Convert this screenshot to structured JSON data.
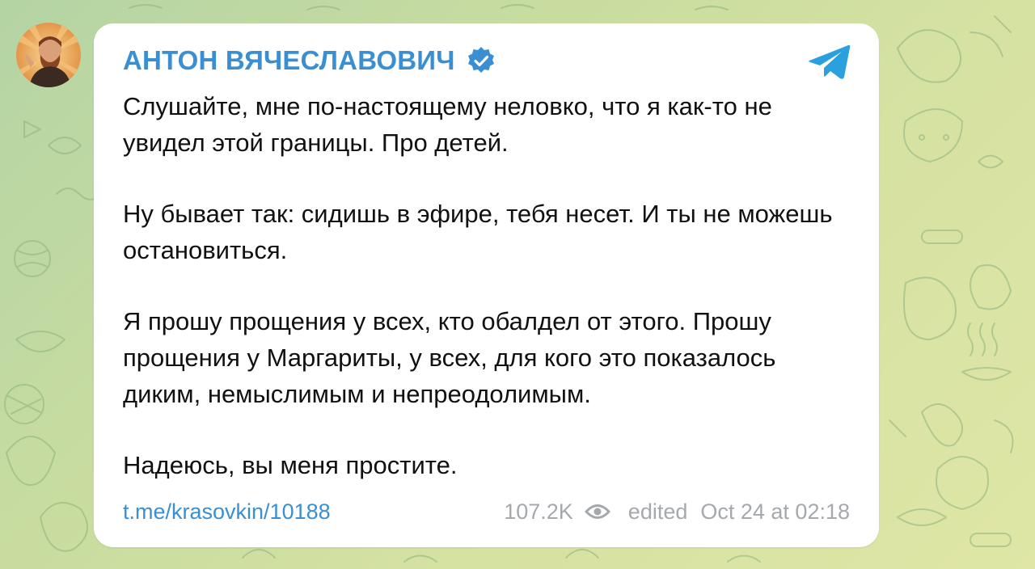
{
  "channel": {
    "name": "АНТОН ВЯЧЕСЛАВОВИЧ",
    "verified": true,
    "avatar_icon": "user-avatar-icon"
  },
  "message": {
    "paragraphs": [
      "Слушайте, мне по-настоящему неловко, что я как-то не увидел этой границы. Про детей.",
      "Ну бывает так: сидишь в эфире, тебя несет. И ты не можешь остановиться.",
      "Я прошу прощения у всех, кто обалдел от этого. Прошу прощения у Маргариты, у всех, для кого это показалось диким, немыслимым и непреодолимым.",
      "Надеюсь, вы меня простите."
    ],
    "link": "t.me/krasovkin/10188",
    "views": "107.2K",
    "edited_label": "edited",
    "timestamp": "Oct 24 at 02:18"
  },
  "icons": {
    "verified": "verified-badge-icon",
    "views": "eye-icon",
    "brand": "telegram-icon"
  },
  "colors": {
    "accent": "#3a8fd3",
    "meta_text": "#a5a9ad",
    "body_text": "#111111",
    "telegram": "#2aa1de"
  }
}
